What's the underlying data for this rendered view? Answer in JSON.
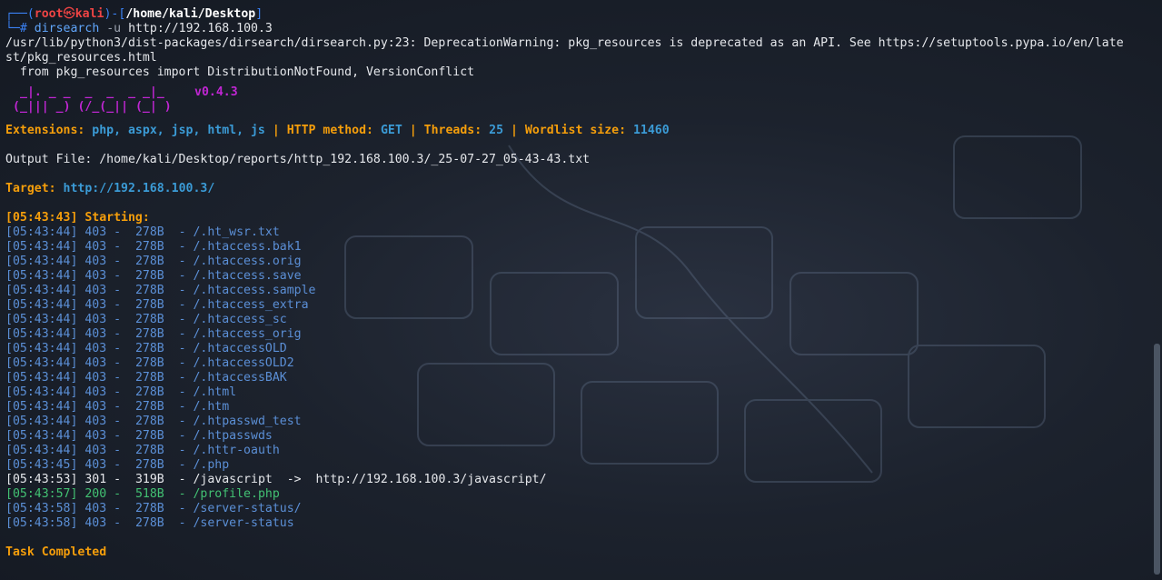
{
  "prompt": {
    "frame_top": "┌──(",
    "user": "root",
    "skull": "㉿",
    "host": "kali",
    "sep": ")-[",
    "path": "/home/kali/Desktop",
    "close": "]",
    "frame_bottom": "└─",
    "hash": "#",
    "command": "dirsearch",
    "flag": "-u",
    "target_arg": "http://192.168.100.3"
  },
  "warning_lines": [
    "/usr/lib/python3/dist-packages/dirsearch/dirsearch.py:23: DeprecationWarning: pkg_resources is deprecated as an API. See https://setuptools.pypa.io/en/late",
    "st/pkg_resources.html",
    "  from pkg_resources import DistributionNotFound, VersionConflict"
  ],
  "banner": {
    "line1": "_|. _ _  _  _  _ _|_",
    "line2": "(_||| _) (/_(_|| (_| )",
    "version": "v0.4.3"
  },
  "config": {
    "ext_label": "Extensions:",
    "ext_value": "php, aspx, jsp, html, js",
    "pipe": "|",
    "method_label": "HTTP method:",
    "method_value": "GET",
    "threads_label": "Threads:",
    "threads_value": "25",
    "wordlist_label": "Wordlist size:",
    "wordlist_value": "11460"
  },
  "output_file": "Output File: /home/kali/Desktop/reports/http_192.168.100.3/_25-07-27_05-43-43.txt",
  "target": {
    "label": "Target:",
    "value": "http://192.168.100.3/"
  },
  "starting": "[05:43:43] Starting:",
  "results": [
    {
      "time": "[05:43:44]",
      "code": "403",
      "size": "278B",
      "path": "/.ht_wsr.txt"
    },
    {
      "time": "[05:43:44]",
      "code": "403",
      "size": "278B",
      "path": "/.htaccess.bak1"
    },
    {
      "time": "[05:43:44]",
      "code": "403",
      "size": "278B",
      "path": "/.htaccess.orig"
    },
    {
      "time": "[05:43:44]",
      "code": "403",
      "size": "278B",
      "path": "/.htaccess.save"
    },
    {
      "time": "[05:43:44]",
      "code": "403",
      "size": "278B",
      "path": "/.htaccess.sample"
    },
    {
      "time": "[05:43:44]",
      "code": "403",
      "size": "278B",
      "path": "/.htaccess_extra"
    },
    {
      "time": "[05:43:44]",
      "code": "403",
      "size": "278B",
      "path": "/.htaccess_sc"
    },
    {
      "time": "[05:43:44]",
      "code": "403",
      "size": "278B",
      "path": "/.htaccess_orig"
    },
    {
      "time": "[05:43:44]",
      "code": "403",
      "size": "278B",
      "path": "/.htaccessOLD"
    },
    {
      "time": "[05:43:44]",
      "code": "403",
      "size": "278B",
      "path": "/.htaccessOLD2"
    },
    {
      "time": "[05:43:44]",
      "code": "403",
      "size": "278B",
      "path": "/.htaccessBAK"
    },
    {
      "time": "[05:43:44]",
      "code": "403",
      "size": "278B",
      "path": "/.html"
    },
    {
      "time": "[05:43:44]",
      "code": "403",
      "size": "278B",
      "path": "/.htm"
    },
    {
      "time": "[05:43:44]",
      "code": "403",
      "size": "278B",
      "path": "/.htpasswd_test"
    },
    {
      "time": "[05:43:44]",
      "code": "403",
      "size": "278B",
      "path": "/.htpasswds"
    },
    {
      "time": "[05:43:44]",
      "code": "403",
      "size": "278B",
      "path": "/.httr-oauth"
    },
    {
      "time": "[05:43:45]",
      "code": "403",
      "size": "278B",
      "path": "/.php"
    },
    {
      "time": "[05:43:53]",
      "code": "301",
      "size": "319B",
      "path": "/javascript",
      "redirect": "  ->  http://192.168.100.3/javascript/"
    },
    {
      "time": "[05:43:57]",
      "code": "200",
      "size": "518B",
      "path": "/profile.php"
    },
    {
      "time": "[05:43:58]",
      "code": "403",
      "size": "278B",
      "path": "/server-status/"
    },
    {
      "time": "[05:43:58]",
      "code": "403",
      "size": "278B",
      "path": "/server-status"
    }
  ],
  "task_completed": "Task Completed",
  "colors": {
    "accent_blue": "#3b82f6",
    "prompt_red": "#ef4444",
    "label_orange": "#f59e0b",
    "value_blue": "#3b9bd6",
    "banner_purple": "#c026d3",
    "status_200": "#4ade80"
  }
}
